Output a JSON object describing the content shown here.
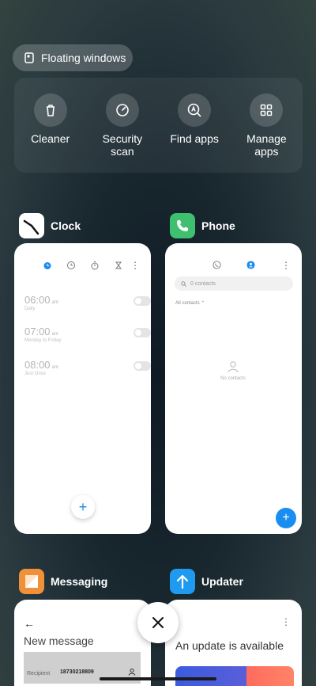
{
  "floating_windows": {
    "label": "Floating windows"
  },
  "quick_actions": [
    {
      "label": "Cleaner",
      "icon": "trash-icon"
    },
    {
      "label": "Security scan",
      "icon": "speedometer-icon"
    },
    {
      "label": "Find apps",
      "icon": "search-app-icon"
    },
    {
      "label": "Manage apps",
      "icon": "grid-icon"
    }
  ],
  "apps": {
    "clock": {
      "name": "Clock",
      "alarms": [
        {
          "time": "06:00",
          "ampm": "am",
          "repeat": "Daily"
        },
        {
          "time": "07:00",
          "ampm": "am",
          "repeat": "Monday to Friday"
        },
        {
          "time": "08:00",
          "ampm": "am",
          "repeat": "Just Once"
        }
      ],
      "fab": "+"
    },
    "phone": {
      "name": "Phone",
      "search_placeholder": "0 contacts",
      "all_contacts": "All contacts",
      "empty_text": "No contacts",
      "fab": "+"
    },
    "messaging": {
      "name": "Messaging",
      "title": "New message",
      "recipient_label": "Recipient",
      "recipient_number": "18730218809"
    },
    "updater": {
      "name": "Updater",
      "title": "An update is available"
    }
  },
  "colors": {
    "accent_blue": "#1a8df0",
    "phone_green": "#3ec06e",
    "messaging_orange": "#f0913a",
    "updater_blue": "#1e9bf0"
  }
}
